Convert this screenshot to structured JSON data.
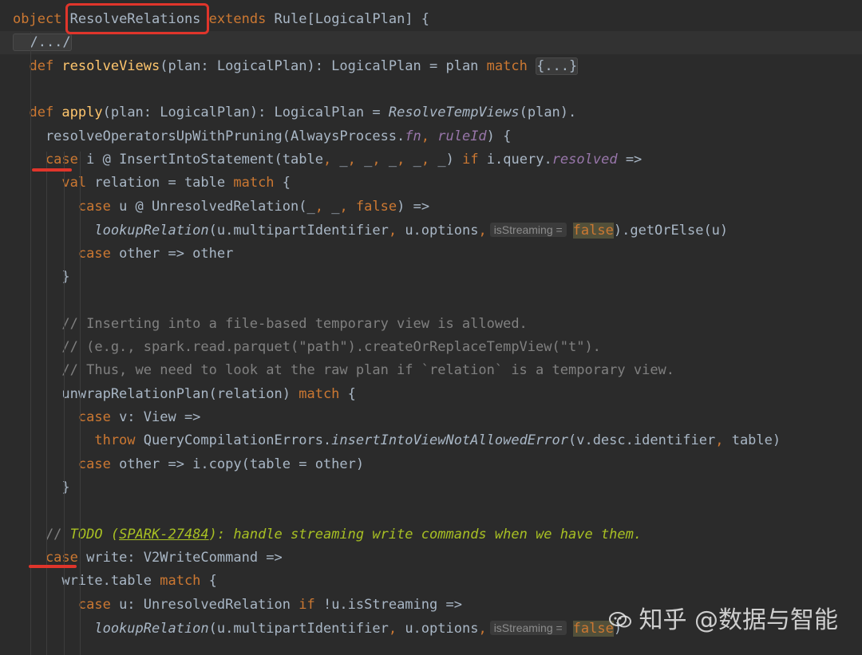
{
  "lines": [
    [
      {
        "t": "object ",
        "c": "kw"
      },
      {
        "t": "ResolveRelations",
        "c": "plain"
      },
      {
        "t": " extends ",
        "c": "kw"
      },
      {
        "t": "Rule[LogicalPlan] {",
        "c": "plain"
      }
    ],
    [
      {
        "t": "  /.../",
        "c": "fold"
      }
    ],
    [
      {
        "t": "  def ",
        "c": "kw"
      },
      {
        "t": "resolveViews",
        "c": "fn"
      },
      {
        "t": "(plan: LogicalPlan): LogicalPlan = plan ",
        "c": "plain"
      },
      {
        "t": "match ",
        "c": "kw"
      },
      {
        "t": "{...}",
        "c": "fold"
      }
    ],
    [],
    [
      {
        "t": "  def ",
        "c": "kw"
      },
      {
        "t": "apply",
        "c": "fn"
      },
      {
        "t": "(plan: LogicalPlan): LogicalPlan = ",
        "c": "plain"
      },
      {
        "t": "ResolveTempViews",
        "c": "it"
      },
      {
        "t": "(plan).",
        "c": "plain"
      }
    ],
    [
      {
        "t": "    resolveOperatorsUpWithPruning(AlwaysProcess.",
        "c": "plain"
      },
      {
        "t": "fn",
        "c": "prop"
      },
      {
        "t": ", ",
        "c": "kw"
      },
      {
        "t": "ruleId",
        "c": "prop"
      },
      {
        "t": ") {",
        "c": "plain"
      }
    ],
    [
      {
        "t": "    case ",
        "c": "kw"
      },
      {
        "t": "i @ InsertIntoStatement(table",
        "c": "plain"
      },
      {
        "t": ", ",
        "c": "kw"
      },
      {
        "t": "_",
        "c": "plain"
      },
      {
        "t": ", ",
        "c": "kw"
      },
      {
        "t": "_",
        "c": "plain"
      },
      {
        "t": ", ",
        "c": "kw"
      },
      {
        "t": "_",
        "c": "plain"
      },
      {
        "t": ", ",
        "c": "kw"
      },
      {
        "t": "_",
        "c": "plain"
      },
      {
        "t": ", ",
        "c": "kw"
      },
      {
        "t": "_) ",
        "c": "plain"
      },
      {
        "t": "if ",
        "c": "kw"
      },
      {
        "t": "i.query.",
        "c": "plain"
      },
      {
        "t": "resolved",
        "c": "prop"
      },
      {
        "t": " =>",
        "c": "plain"
      }
    ],
    [
      {
        "t": "      val ",
        "c": "kw"
      },
      {
        "t": "relation = table ",
        "c": "plain"
      },
      {
        "t": "match ",
        "c": "kw"
      },
      {
        "t": "{",
        "c": "plain"
      }
    ],
    [
      {
        "t": "        case ",
        "c": "kw"
      },
      {
        "t": "u @ UnresolvedRelation(_",
        "c": "plain"
      },
      {
        "t": ", ",
        "c": "kw"
      },
      {
        "t": "_",
        "c": "plain"
      },
      {
        "t": ", ",
        "c": "kw"
      },
      {
        "t": "false",
        "c": "kw"
      },
      {
        "t": ") =>",
        "c": "plain"
      }
    ],
    [
      {
        "t": "          ",
        "c": "plain"
      },
      {
        "t": "lookupRelation",
        "c": "it"
      },
      {
        "t": "(u.multipartIdentifier",
        "c": "plain"
      },
      {
        "t": ", ",
        "c": "kw"
      },
      {
        "t": "u.options",
        "c": "plain"
      },
      {
        "t": ",",
        "c": "kw"
      },
      {
        "t": "isStreaming =",
        "c": "hint"
      },
      {
        "t": "false",
        "c": "kwhl"
      },
      {
        "t": ").getOrElse(u)",
        "c": "plain"
      }
    ],
    [
      {
        "t": "        case ",
        "c": "kw"
      },
      {
        "t": "other => other",
        "c": "plain"
      }
    ],
    [
      {
        "t": "      }",
        "c": "plain"
      }
    ],
    [],
    [
      {
        "t": "      // Inserting into a file-based temporary view is allowed.",
        "c": "cm"
      }
    ],
    [
      {
        "t": "      // (e.g., spark.read.parquet(\"path\").createOrReplaceTempView(\"t\").",
        "c": "cm"
      }
    ],
    [
      {
        "t": "      // Thus, we need to look at the raw plan if `relation` is a temporary view.",
        "c": "cm"
      }
    ],
    [
      {
        "t": "      unwrapRelationPlan(relation) ",
        "c": "plain"
      },
      {
        "t": "match ",
        "c": "kw"
      },
      {
        "t": "{",
        "c": "plain"
      }
    ],
    [
      {
        "t": "        case ",
        "c": "kw"
      },
      {
        "t": "v: View =>",
        "c": "plain"
      }
    ],
    [
      {
        "t": "          throw ",
        "c": "kw"
      },
      {
        "t": "QueryCompilationErrors.",
        "c": "plain"
      },
      {
        "t": "insertIntoViewNotAllowedError",
        "c": "it"
      },
      {
        "t": "(v.desc.identifier",
        "c": "plain"
      },
      {
        "t": ", ",
        "c": "kw"
      },
      {
        "t": "table)",
        "c": "plain"
      }
    ],
    [
      {
        "t": "        case ",
        "c": "kw"
      },
      {
        "t": "other => i.copy(table = other)",
        "c": "plain"
      }
    ],
    [
      {
        "t": "      }",
        "c": "plain"
      }
    ],
    [],
    [
      {
        "t": "    // ",
        "c": "cm"
      },
      {
        "t": "TODO (",
        "c": "todo"
      },
      {
        "t": "SPARK-27484",
        "c": "todolink"
      },
      {
        "t": "): handle streaming write commands when we have them.",
        "c": "todo"
      }
    ],
    [
      {
        "t": "    case ",
        "c": "kw"
      },
      {
        "t": "write: V2WriteCommand =>",
        "c": "plain"
      }
    ],
    [
      {
        "t": "      write.table ",
        "c": "plain"
      },
      {
        "t": "match ",
        "c": "kw"
      },
      {
        "t": "{",
        "c": "plain"
      }
    ],
    [
      {
        "t": "        case ",
        "c": "kw"
      },
      {
        "t": "u: UnresolvedRelation ",
        "c": "plain"
      },
      {
        "t": "if ",
        "c": "kw"
      },
      {
        "t": "!u.isStreaming =>",
        "c": "plain"
      }
    ],
    [
      {
        "t": "          ",
        "c": "plain"
      },
      {
        "t": "lookupRelation",
        "c": "it"
      },
      {
        "t": "(u.multipartIdentifier",
        "c": "plain"
      },
      {
        "t": ", ",
        "c": "kw"
      },
      {
        "t": "u.options",
        "c": "plain"
      },
      {
        "t": ",",
        "c": "kw"
      },
      {
        "t": "isStreaming =",
        "c": "hint"
      },
      {
        "t": "false",
        "c": "kwhl"
      },
      {
        "t": ")",
        "c": "plain"
      }
    ]
  ],
  "watermark": "知乎 @数据与智能"
}
